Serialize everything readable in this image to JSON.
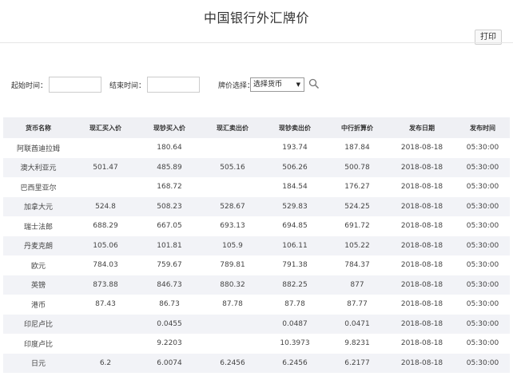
{
  "page": {
    "title": "中国银行外汇牌价",
    "print_label": "打印"
  },
  "filters": {
    "start_label": "起始时间：",
    "end_label": "结束时间：",
    "currency_label": "牌价选择：",
    "currency_value": "选择货币",
    "search_icon": "magnifier-icon"
  },
  "table": {
    "headers": [
      "货币名称",
      "现汇买入价",
      "现钞买入价",
      "现汇卖出价",
      "现钞卖出价",
      "中行折算价",
      "发布日期",
      "发布时间"
    ],
    "rows": [
      [
        "阿联酋迪拉姆",
        "",
        "180.64",
        "",
        "193.74",
        "187.84",
        "2018-08-18",
        "05:30:00"
      ],
      [
        "澳大利亚元",
        "501.47",
        "485.89",
        "505.16",
        "506.26",
        "500.78",
        "2018-08-18",
        "05:30:00"
      ],
      [
        "巴西里亚尔",
        "",
        "168.72",
        "",
        "184.54",
        "176.27",
        "2018-08-18",
        "05:30:00"
      ],
      [
        "加拿大元",
        "524.8",
        "508.23",
        "528.67",
        "529.83",
        "524.25",
        "2018-08-18",
        "05:30:00"
      ],
      [
        "瑞士法郎",
        "688.29",
        "667.05",
        "693.13",
        "694.85",
        "691.72",
        "2018-08-18",
        "05:30:00"
      ],
      [
        "丹麦克朗",
        "105.06",
        "101.81",
        "105.9",
        "106.11",
        "105.22",
        "2018-08-18",
        "05:30:00"
      ],
      [
        "欧元",
        "784.03",
        "759.67",
        "789.81",
        "791.38",
        "784.37",
        "2018-08-18",
        "05:30:00"
      ],
      [
        "英镑",
        "873.88",
        "846.73",
        "880.32",
        "882.25",
        "877",
        "2018-08-18",
        "05:30:00"
      ],
      [
        "港币",
        "87.43",
        "86.73",
        "87.78",
        "87.78",
        "87.77",
        "2018-08-18",
        "05:30:00"
      ],
      [
        "印尼卢比",
        "",
        "0.0455",
        "",
        "0.0487",
        "0.0471",
        "2018-08-18",
        "05:30:00"
      ],
      [
        "印度卢比",
        "",
        "9.2203",
        "",
        "10.3973",
        "9.8231",
        "2018-08-18",
        "05:30:00"
      ],
      [
        "日元",
        "6.2",
        "6.0074",
        "6.2456",
        "6.2456",
        "6.2177",
        "2018-08-18",
        "05:30:00"
      ]
    ]
  }
}
